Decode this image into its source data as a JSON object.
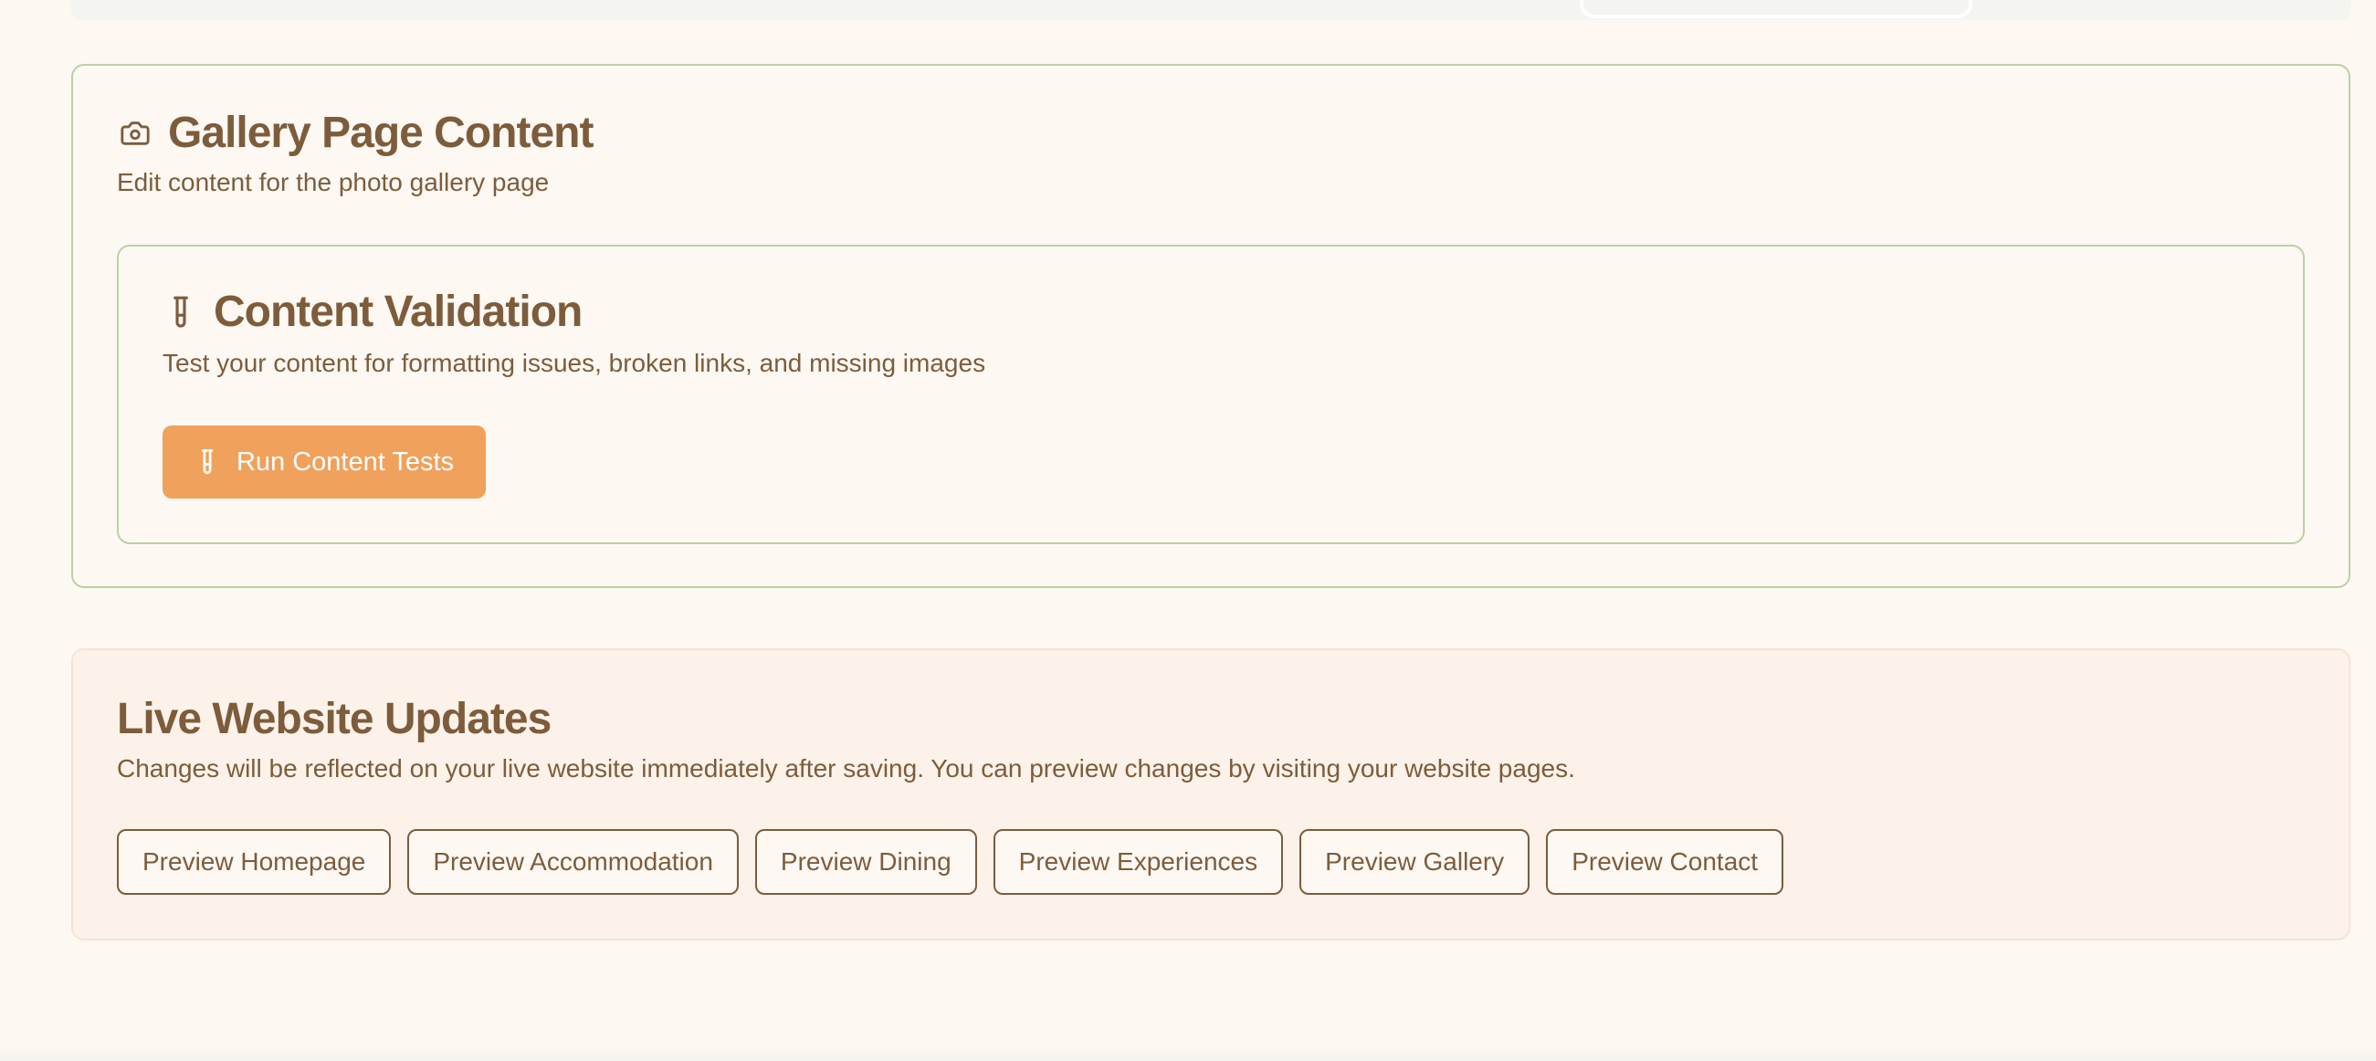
{
  "gallery_section": {
    "icon": "camera-icon",
    "title": "Gallery Page Content",
    "description": "Edit content for the photo gallery page"
  },
  "validation_section": {
    "icon": "test-tube-icon",
    "title": "Content Validation",
    "description": "Test your content for formatting issues, broken links, and missing images",
    "run_button": {
      "icon": "test-tube-icon",
      "label": "Run Content Tests"
    }
  },
  "live_section": {
    "title": "Live Website Updates",
    "description": "Changes will be reflected on your live website immediately after saving. You can preview changes by visiting your website pages.",
    "buttons": [
      {
        "label": "Preview Homepage"
      },
      {
        "label": "Preview Accommodation"
      },
      {
        "label": "Preview Dining"
      },
      {
        "label": "Preview Experiences"
      },
      {
        "label": "Preview Gallery"
      },
      {
        "label": "Preview Contact"
      }
    ]
  },
  "colors": {
    "background": "#fdf8f2",
    "text_brown": "#7d5c3c",
    "card_border_green": "#bcd0a6",
    "accent_orange": "#f0a15c",
    "live_card_background": "#fcf2e9"
  }
}
